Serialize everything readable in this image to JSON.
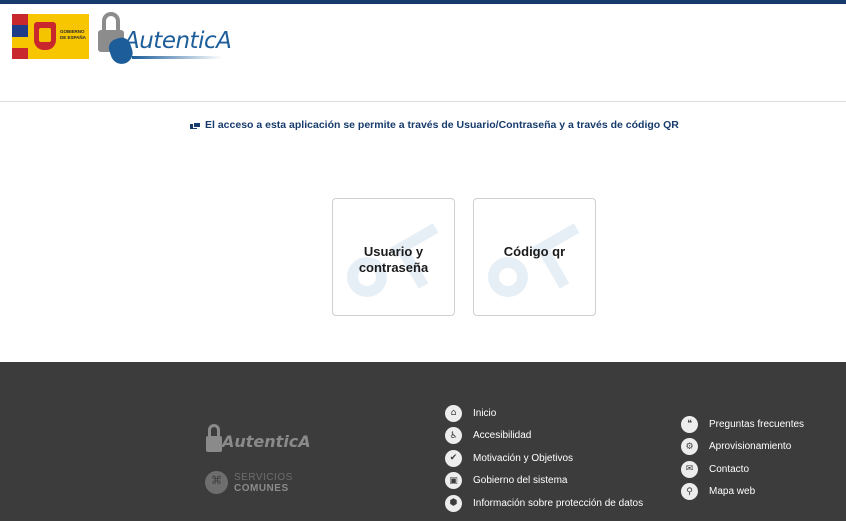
{
  "header": {
    "gov_logo_text": [
      "GOBIERNO",
      "DE ESPAÑA"
    ],
    "app_logo_text": "AutenticA"
  },
  "notice": {
    "text": "El acceso a esta aplicación se permite a través de Usuario/Contraseña y a través de código QR",
    "icon": "chat-bubbles-icon"
  },
  "login_options": [
    {
      "label_line1": "Usuario y",
      "label_line2": "contraseña"
    },
    {
      "label_line1": "Código qr",
      "label_line2": ""
    }
  ],
  "footer": {
    "logo_text": "AutenticA",
    "servicios_line1": "SERVICIOS",
    "servicios_line2": "COMUNES",
    "links_col1": [
      {
        "label": "Inicio",
        "icon": "home-icon"
      },
      {
        "label": "Accesibilidad",
        "icon": "accessibility-icon"
      },
      {
        "label": "Motivación y Objetivos",
        "icon": "check-icon"
      },
      {
        "label": "Gobierno del sistema",
        "icon": "briefcase-icon"
      },
      {
        "label": "Información sobre protección de datos",
        "icon": "shield-icon"
      }
    ],
    "links_col2": [
      {
        "label": "Preguntas frecuentes",
        "icon": "chat-bubbles-icon"
      },
      {
        "label": "Aprovisionamiento",
        "icon": "gear-icon"
      },
      {
        "label": "Contacto",
        "icon": "envelope-icon"
      },
      {
        "label": "Mapa web",
        "icon": "search-icon"
      }
    ]
  },
  "colors": {
    "brand_blue": "#173b6c",
    "logo_blue": "#1d5e9a",
    "footer_bg": "#3c3c3c",
    "watermark": "#e7eff6"
  }
}
